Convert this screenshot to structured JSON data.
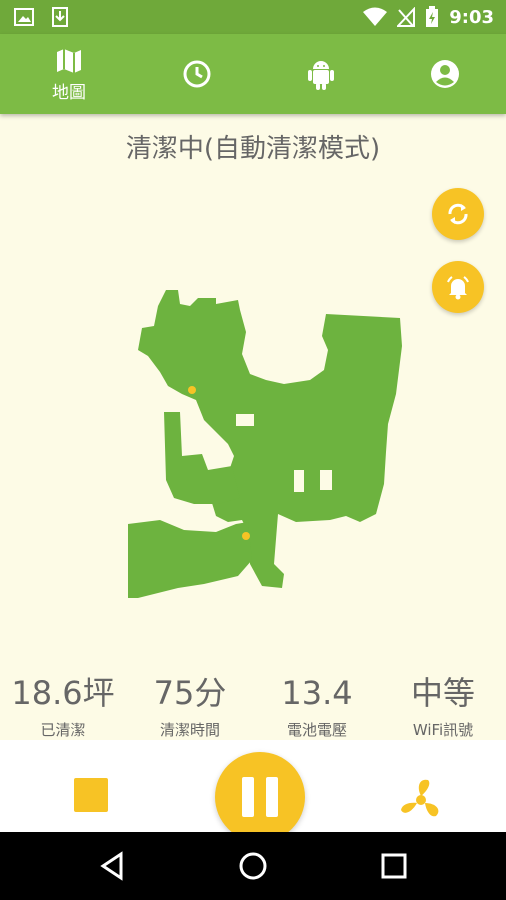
{
  "status_bar": {
    "time": "9:03"
  },
  "tabs": [
    {
      "label": "地圖",
      "icon": "map-icon",
      "active": true
    },
    {
      "icon": "clock-icon"
    },
    {
      "icon": "android-icon"
    },
    {
      "icon": "account-icon"
    }
  ],
  "status_title": "清潔中(自動清潔模式)",
  "stats": [
    {
      "value": "18.6坪",
      "label": "已清潔"
    },
    {
      "value": "75分",
      "label": "清潔時間"
    },
    {
      "value": "13.4",
      "label": "電池電壓"
    },
    {
      "value": "中等",
      "label": "WiFi訊號"
    }
  ],
  "colors": {
    "primary": "#7dbb45",
    "status_bar": "#6fa93a",
    "accent": "#f7c325",
    "background": "#fdfbe6",
    "map_fill": "#6db33f"
  }
}
